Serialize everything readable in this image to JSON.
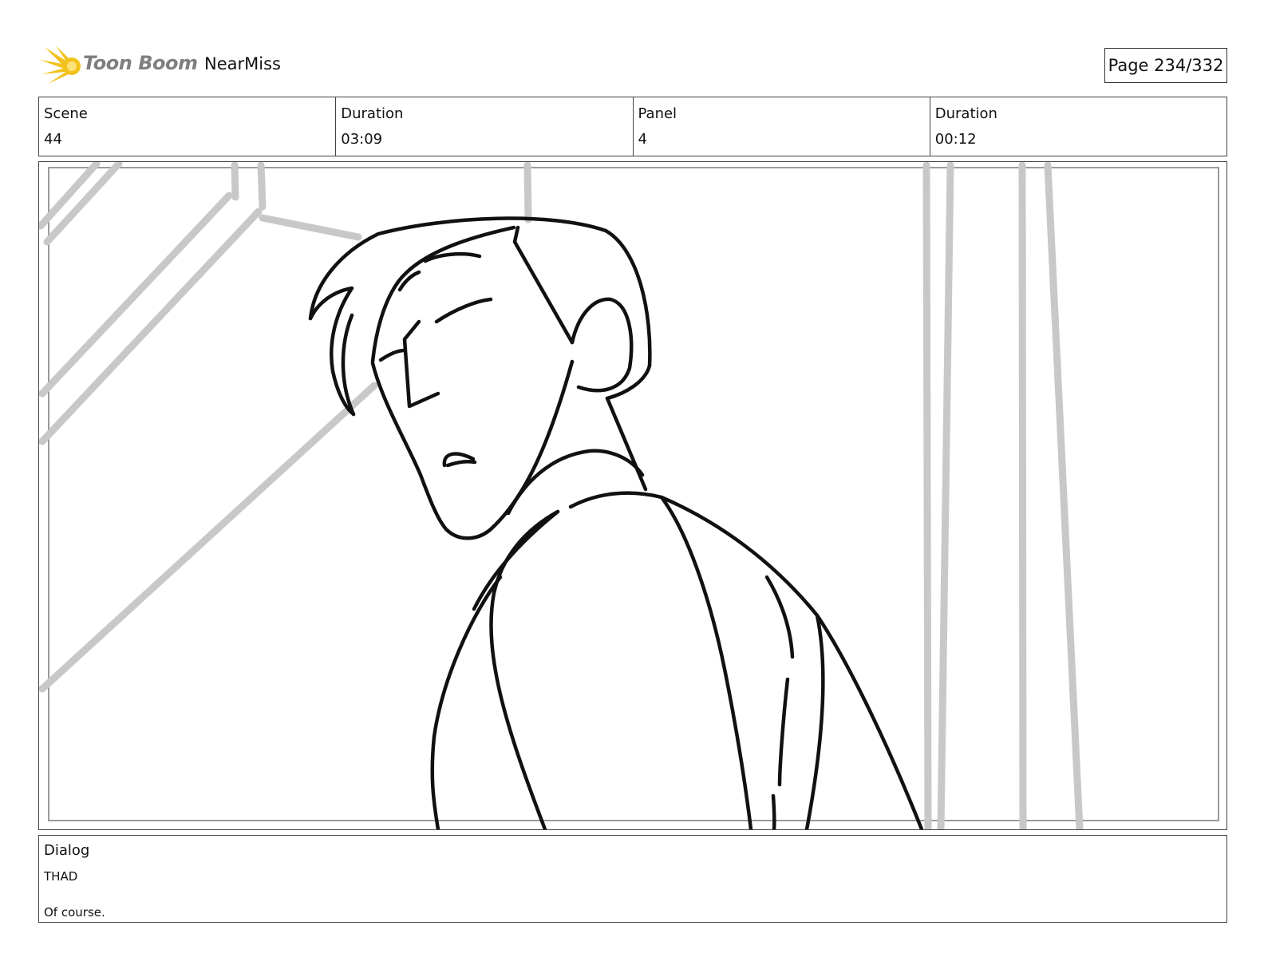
{
  "header": {
    "logo_text": "Toon Boom",
    "project_title": "NearMiss",
    "page_indicator": "Page 234/332"
  },
  "info": {
    "scene_label": "Scene",
    "scene_value": "44",
    "scene_duration_label": "Duration",
    "scene_duration_value": "03:09",
    "panel_label": "Panel",
    "panel_value": "4",
    "panel_duration_label": "Duration",
    "panel_duration_value": "00:12"
  },
  "dialog": {
    "label": "Dialog",
    "speaker": "THAD",
    "line": "Of course."
  },
  "colors": {
    "logo_sun": "#f2c21b",
    "logo_text": "#7f7f7f",
    "sketch_line": "#111111",
    "background_sketch": "#c8c8c8"
  }
}
